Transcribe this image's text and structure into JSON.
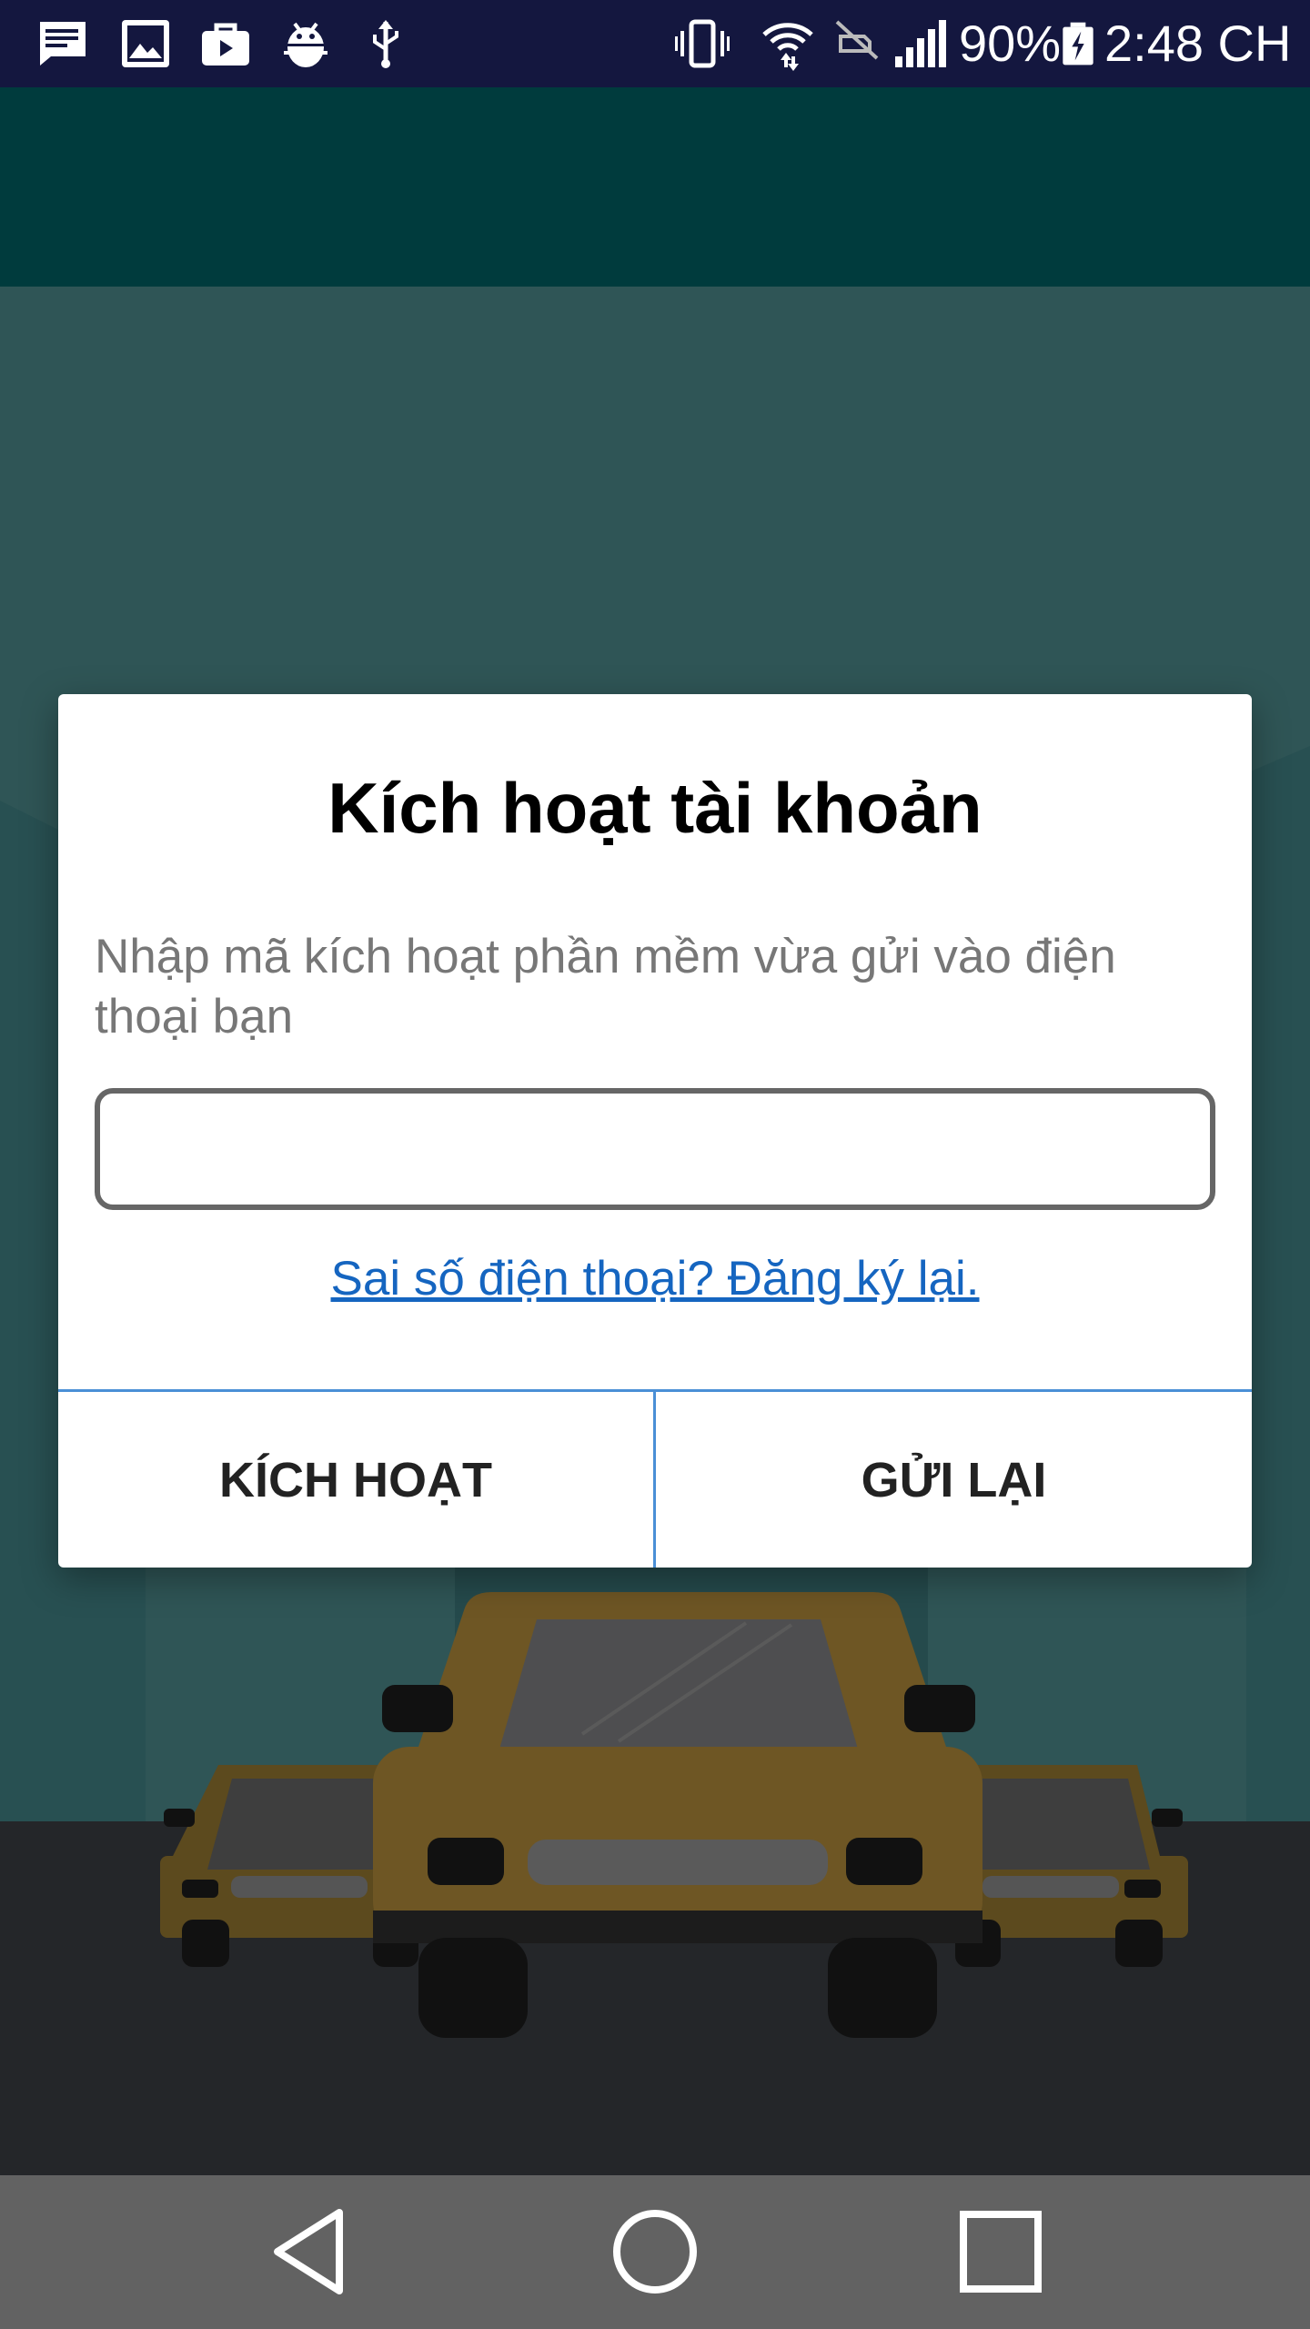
{
  "status_bar": {
    "battery_percent": "90%",
    "time": "2:48 CH",
    "left_icons": [
      "message-icon",
      "image-icon",
      "briefcase-icon",
      "android-debug-icon",
      "usb-icon"
    ],
    "right_icons": [
      "vibrate-icon",
      "wifi-icon",
      "no-sim-icon",
      "signal-icon",
      "battery-charging-icon"
    ]
  },
  "dialog": {
    "title": "Kích hoạt tài khoản",
    "message": "Nhập mã kích hoạt phần mềm vừa gửi vào điện thoại bạn",
    "code_input": {
      "value": "",
      "placeholder": ""
    },
    "link": "Sai số điện thoại? Đăng ký lại.",
    "buttons": {
      "activate": "KÍCH HOẠT",
      "resend": "GỬI LẠI"
    }
  },
  "nav_bar": {
    "buttons": [
      "back-icon",
      "home-icon",
      "recents-icon"
    ]
  },
  "colors": {
    "status_bar": "#14173f",
    "header": "#003b3d",
    "background": "#2f5556",
    "link": "#1565c0",
    "divider": "#4a8fd6",
    "nav_bar": "#626262"
  }
}
